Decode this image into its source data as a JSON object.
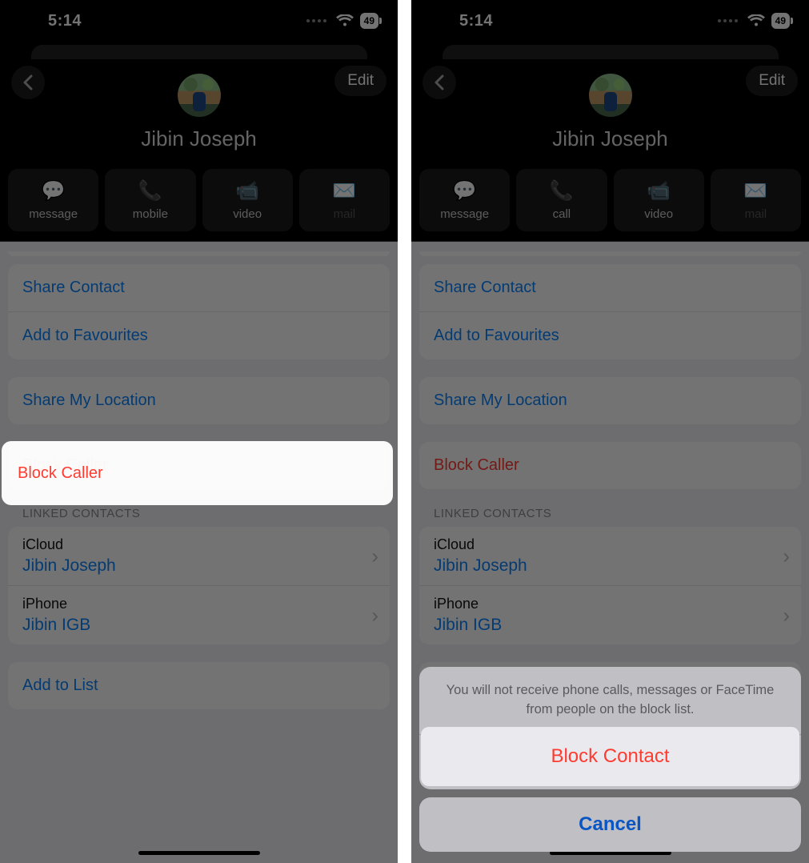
{
  "status": {
    "time": "5:14",
    "battery": "49"
  },
  "header": {
    "edit": "Edit",
    "contact_name": "Jibin Joseph"
  },
  "actionsA": [
    {
      "id": "message",
      "label": "message",
      "glyph": "💬"
    },
    {
      "id": "mobile",
      "label": "mobile",
      "glyph": "📞"
    },
    {
      "id": "video",
      "label": "video",
      "glyph": "📹"
    },
    {
      "id": "mail",
      "label": "mail",
      "glyph": "✉️",
      "disabled": true
    }
  ],
  "actionsB": [
    {
      "id": "message",
      "label": "message",
      "glyph": "💬"
    },
    {
      "id": "call",
      "label": "call",
      "glyph": "📞"
    },
    {
      "id": "video",
      "label": "video",
      "glyph": "📹"
    },
    {
      "id": "mail",
      "label": "mail",
      "glyph": "✉️",
      "disabled": true
    }
  ],
  "rows": {
    "share_contact": "Share Contact",
    "add_fav": "Add to Favourites",
    "share_loc": "Share My Location",
    "block": "Block Caller",
    "add_list": "Add to List"
  },
  "linked": {
    "header": "LINKED CONTACTS",
    "items": [
      {
        "source": "iCloud",
        "name": "Jibin Joseph"
      },
      {
        "source": "iPhone",
        "name": "Jibin IGB"
      }
    ]
  },
  "sheet": {
    "message": "You will not receive phone calls, messages or FaceTime from people on the block list.",
    "action": "Block Contact",
    "cancel": "Cancel"
  }
}
